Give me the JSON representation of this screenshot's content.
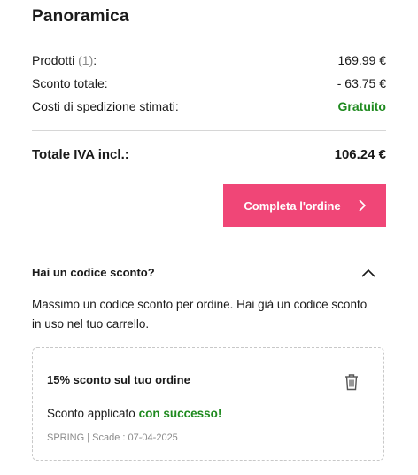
{
  "summary": {
    "title": "Panoramica",
    "products_label": "Prodotti",
    "products_count": "(1)",
    "products_suffix": ":",
    "products_value": "169.99 €",
    "discount_label": "Sconto totale:",
    "discount_value": "- 63.75 €",
    "shipping_label": "Costi di spedizione stimati:",
    "shipping_value": "Gratuito",
    "total_label": "Totale IVA incl.:",
    "total_value": "106.24 €",
    "checkout_label": "Completa l'ordine"
  },
  "coupon": {
    "heading": "Hai un codice sconto?",
    "description": "Massimo un codice sconto per ordine. Hai già un codice sconto in uso nel tuo carrello.",
    "card_title": "15% sconto sul tuo ordine",
    "applied_prefix": "Sconto applicato",
    "applied_success": "con successo!",
    "code": "SPRING",
    "separator": "|",
    "expiry": "Scade : 07-04-2025"
  },
  "colors": {
    "accent": "#f04677",
    "success": "#1f8a1f"
  }
}
